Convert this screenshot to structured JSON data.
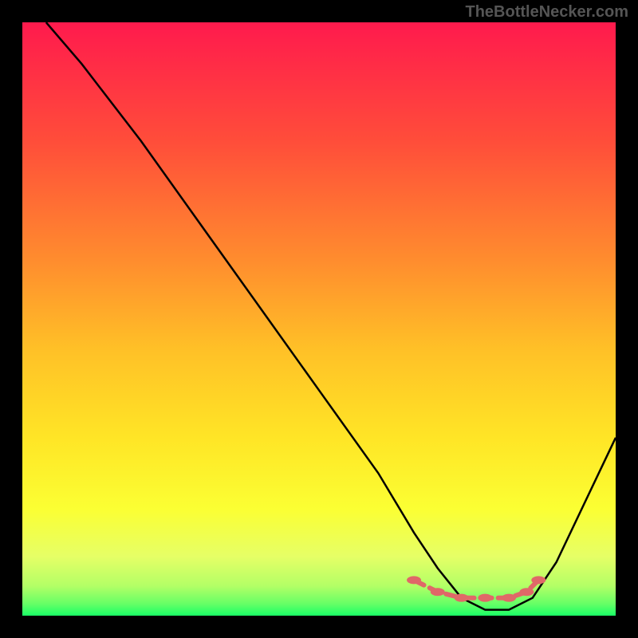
{
  "watermark": "TheBottleNecker.com",
  "chart_data": {
    "type": "line",
    "title": "",
    "xlabel": "",
    "ylabel": "",
    "xlim": [
      0,
      100
    ],
    "ylim": [
      0,
      100
    ],
    "series": [
      {
        "name": "curve",
        "x": [
          4,
          10,
          20,
          30,
          40,
          50,
          60,
          66,
          70,
          74,
          78,
          82,
          86,
          90,
          100
        ],
        "y": [
          100,
          93,
          80,
          66,
          52,
          38,
          24,
          14,
          8,
          3,
          1,
          1,
          3,
          9,
          30
        ]
      }
    ],
    "markers": {
      "name": "flat-region",
      "x": [
        66,
        70,
        74,
        78,
        82,
        85,
        87
      ],
      "y": [
        6,
        4,
        3,
        3,
        3,
        4,
        6
      ]
    },
    "gradient_stops": [
      {
        "offset": 0.0,
        "color": "#ff1a4d"
      },
      {
        "offset": 0.2,
        "color": "#ff4d3a"
      },
      {
        "offset": 0.4,
        "color": "#ff8c2e"
      },
      {
        "offset": 0.55,
        "color": "#ffc027"
      },
      {
        "offset": 0.7,
        "color": "#ffe526"
      },
      {
        "offset": 0.82,
        "color": "#fbff33"
      },
      {
        "offset": 0.9,
        "color": "#e6ff66"
      },
      {
        "offset": 0.95,
        "color": "#b3ff66"
      },
      {
        "offset": 0.98,
        "color": "#66ff66"
      },
      {
        "offset": 1.0,
        "color": "#1aff66"
      }
    ]
  }
}
